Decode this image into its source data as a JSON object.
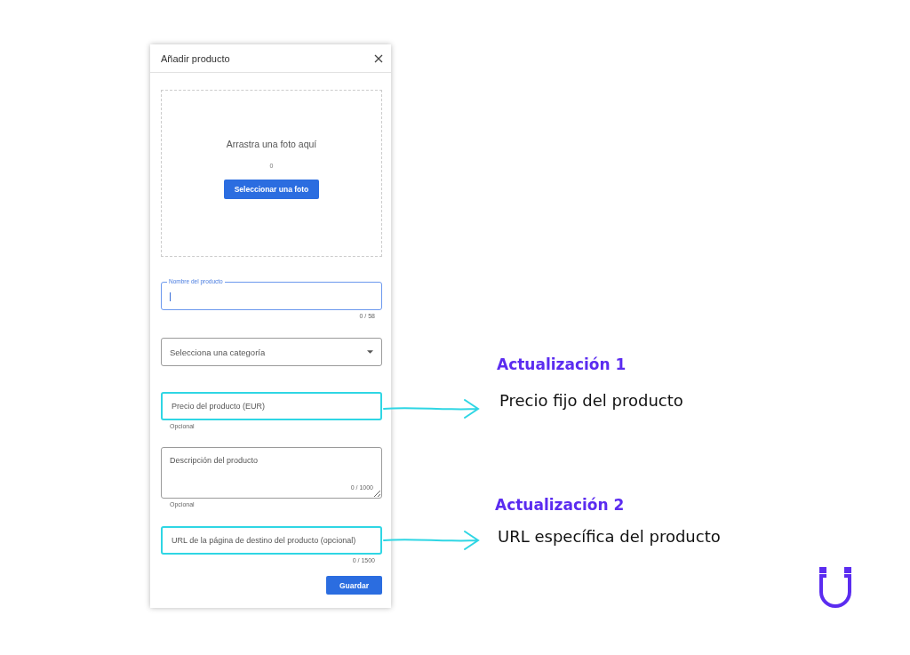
{
  "dialog": {
    "title": "Añadir producto",
    "dropzone": {
      "text": "Arrastra una foto aquí",
      "count": "0",
      "button": "Seleccionar una foto"
    },
    "fields": [
      {
        "kind": "text",
        "label": "Nombre del producto",
        "focused": true,
        "counter": "0 / 58",
        "highlighted": false
      },
      {
        "kind": "select",
        "placeholder": "Selecciona una categoría",
        "highlighted": false
      },
      {
        "kind": "text",
        "placeholder": "Precio del producto (EUR)",
        "hint": "Opcional",
        "highlighted": true
      },
      {
        "kind": "textarea",
        "placeholder": "Descripción del producto",
        "counter": "0 / 1000",
        "hint": "Opcional",
        "highlighted": false
      },
      {
        "kind": "text",
        "placeholder": "URL de la página de destino del producto (opcional)",
        "counter": "0 / 1500",
        "highlighted": true
      }
    ],
    "save_button": "Guardar"
  },
  "annotations": [
    {
      "title": "Actualización 1",
      "text": "Precio fijo del producto"
    },
    {
      "title": "Actualización 2",
      "text": "URL específica del producto"
    }
  ]
}
